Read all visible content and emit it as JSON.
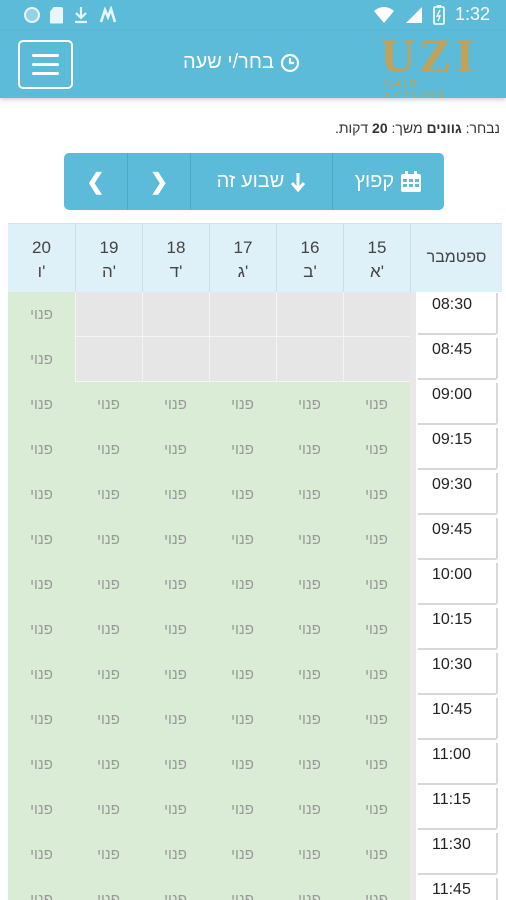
{
  "status_bar": {
    "time": "1:32",
    "icons_left": [
      "circle-icon",
      "sd-card-icon",
      "download-icon",
      "app-notification-icon"
    ],
    "icons_right": [
      "wifi-icon",
      "signal-icon",
      "battery-icon"
    ]
  },
  "app_bar": {
    "title": "בחר/י שעה",
    "logo_main": "UZI",
    "logo_sub": "HAIR STYLING"
  },
  "selection": {
    "prefix": "נבחר:",
    "service": "גוונים",
    "duration_text": "משך:",
    "duration_value": "20",
    "duration_unit": "דקות."
  },
  "nav_buttons": {
    "jump": "קפוץ",
    "this_week": "שבוע זה"
  },
  "table": {
    "month": "ספטמבר",
    "days": [
      {
        "date": "15",
        "day": "א'"
      },
      {
        "date": "16",
        "day": "ב'"
      },
      {
        "date": "17",
        "day": "ג'"
      },
      {
        "date": "18",
        "day": "ד'"
      },
      {
        "date": "19",
        "day": "ה'"
      },
      {
        "date": "20",
        "day": "ו'"
      }
    ],
    "free_label": "פנוי",
    "rows": [
      {
        "time": "08:30",
        "slots": [
          0,
          0,
          0,
          0,
          0,
          1
        ]
      },
      {
        "time": "08:45",
        "slots": [
          0,
          0,
          0,
          0,
          0,
          1
        ]
      },
      {
        "time": "09:00",
        "slots": [
          1,
          1,
          1,
          1,
          1,
          1
        ]
      },
      {
        "time": "09:15",
        "slots": [
          1,
          1,
          1,
          1,
          1,
          1
        ]
      },
      {
        "time": "09:30",
        "slots": [
          1,
          1,
          1,
          1,
          1,
          1
        ]
      },
      {
        "time": "09:45",
        "slots": [
          1,
          1,
          1,
          1,
          1,
          1
        ]
      },
      {
        "time": "10:00",
        "slots": [
          1,
          1,
          1,
          1,
          1,
          1
        ]
      },
      {
        "time": "10:15",
        "slots": [
          1,
          1,
          1,
          1,
          1,
          1
        ]
      },
      {
        "time": "10:30",
        "slots": [
          1,
          1,
          1,
          1,
          1,
          1
        ]
      },
      {
        "time": "10:45",
        "slots": [
          1,
          1,
          1,
          1,
          1,
          1
        ]
      },
      {
        "time": "11:00",
        "slots": [
          1,
          1,
          1,
          1,
          1,
          1
        ]
      },
      {
        "time": "11:15",
        "slots": [
          1,
          1,
          1,
          1,
          1,
          1
        ]
      },
      {
        "time": "11:30",
        "slots": [
          1,
          1,
          1,
          1,
          1,
          1
        ]
      },
      {
        "time": "11:45",
        "slots": [
          1,
          1,
          1,
          1,
          1,
          1
        ]
      }
    ]
  },
  "colors": {
    "primary": "#5bbbd8",
    "free": "#daecd5",
    "closed": "#e6e6e6",
    "header": "#dff1f8",
    "logo": "#c0a25a"
  }
}
